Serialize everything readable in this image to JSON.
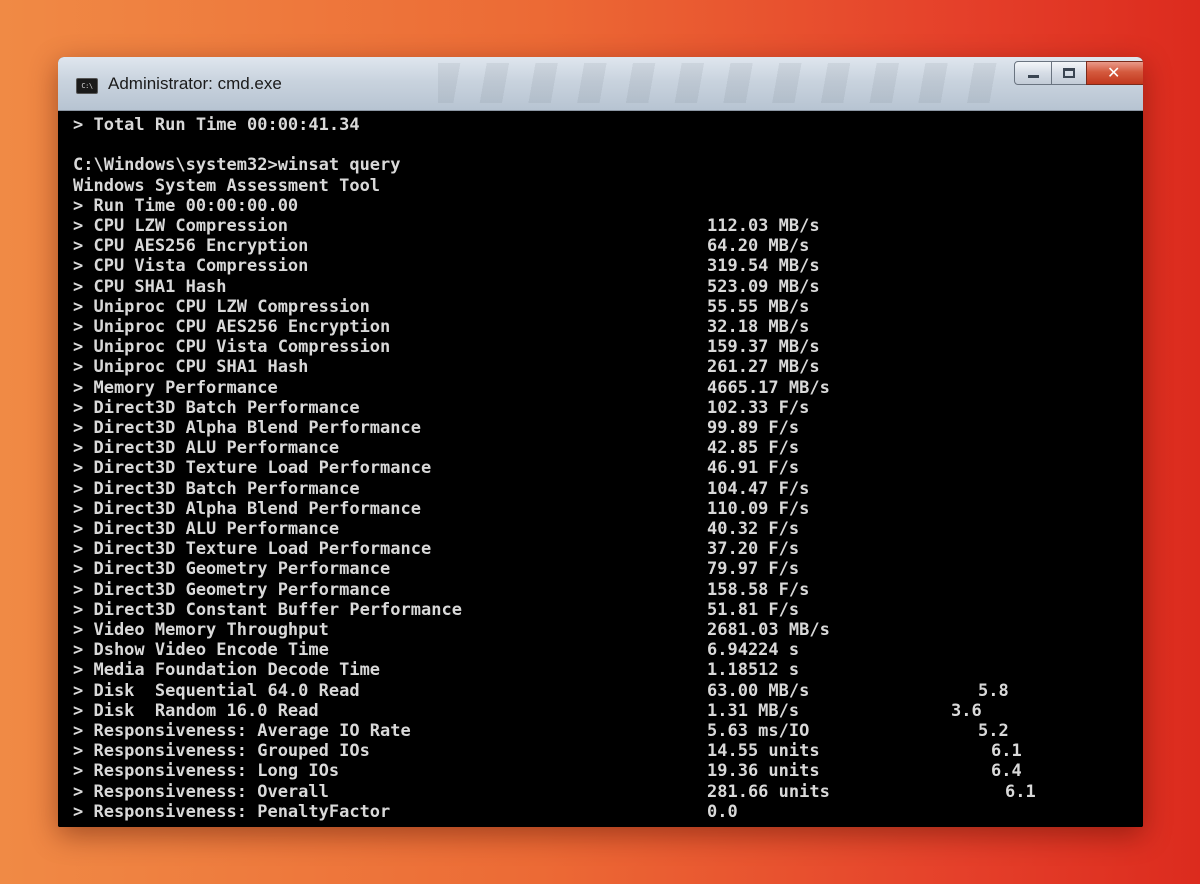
{
  "window": {
    "title": "Administrator: cmd.exe",
    "icon_text": "C:\\",
    "title_icon": "cmd-app-icon",
    "controls": [
      "minimize-icon",
      "maximize-icon",
      "close-icon"
    ]
  },
  "console": {
    "lines": [
      {
        "label": "> Total Run Time 00:00:41.34"
      },
      {
        "label": ""
      },
      {
        "label": "C:\\Windows\\system32>winsat query"
      },
      {
        "label": "Windows System Assessment Tool"
      },
      {
        "label": "> Run Time 00:00:00.00"
      },
      {
        "label": "> CPU LZW Compression",
        "value": "112.03 MB/s"
      },
      {
        "label": "> CPU AES256 Encryption",
        "value": "64.20 MB/s"
      },
      {
        "label": "> CPU Vista Compression",
        "value": "319.54 MB/s"
      },
      {
        "label": "> CPU SHA1 Hash",
        "value": "523.09 MB/s"
      },
      {
        "label": "> Uniproc CPU LZW Compression",
        "value": "55.55 MB/s"
      },
      {
        "label": "> Uniproc CPU AES256 Encryption",
        "value": "32.18 MB/s"
      },
      {
        "label": "> Uniproc CPU Vista Compression",
        "value": "159.37 MB/s"
      },
      {
        "label": "> Uniproc CPU SHA1 Hash",
        "value": "261.27 MB/s"
      },
      {
        "label": "> Memory Performance",
        "value": "4665.17 MB/s"
      },
      {
        "label": "> Direct3D Batch Performance",
        "value": "102.33 F/s"
      },
      {
        "label": "> Direct3D Alpha Blend Performance",
        "value": "99.89 F/s"
      },
      {
        "label": "> Direct3D ALU Performance",
        "value": "42.85 F/s"
      },
      {
        "label": "> Direct3D Texture Load Performance",
        "value": "46.91 F/s"
      },
      {
        "label": "> Direct3D Batch Performance",
        "value": "104.47 F/s"
      },
      {
        "label": "> Direct3D Alpha Blend Performance",
        "value": "110.09 F/s"
      },
      {
        "label": "> Direct3D ALU Performance",
        "value": "40.32 F/s"
      },
      {
        "label": "> Direct3D Texture Load Performance",
        "value": "37.20 F/s"
      },
      {
        "label": "> Direct3D Geometry Performance",
        "value": "79.97 F/s"
      },
      {
        "label": "> Direct3D Geometry Performance",
        "value": "158.58 F/s"
      },
      {
        "label": "> Direct3D Constant Buffer Performance",
        "value": "51.81 F/s"
      },
      {
        "label": "> Video Memory Throughput",
        "value": "2681.03 MB/s"
      },
      {
        "label": "> Dshow Video Encode Time",
        "value": "6.94224 s"
      },
      {
        "label": "> Media Foundation Decode Time",
        "value": "1.18512 s"
      },
      {
        "label": "> Disk  Sequential 64.0 Read",
        "value": "63.00 MB/s",
        "score": "5.8"
      },
      {
        "label": "> Disk  Random 16.0 Read",
        "value": "1.31 MB/s",
        "score": "3.6"
      },
      {
        "label": "> Responsiveness: Average IO Rate",
        "value": "5.63 ms/IO",
        "score": "5.2"
      },
      {
        "label": "> Responsiveness: Grouped IOs",
        "value": "14.55 units",
        "score": "6.1"
      },
      {
        "label": "> Responsiveness: Long IOs",
        "value": "19.36 units",
        "score": "6.4"
      },
      {
        "label": "> Responsiveness: Overall",
        "value": "281.66 units",
        "score": "6.1"
      },
      {
        "label": "> Responsiveness: PenaltyFactor",
        "value": "0.0"
      }
    ]
  }
}
